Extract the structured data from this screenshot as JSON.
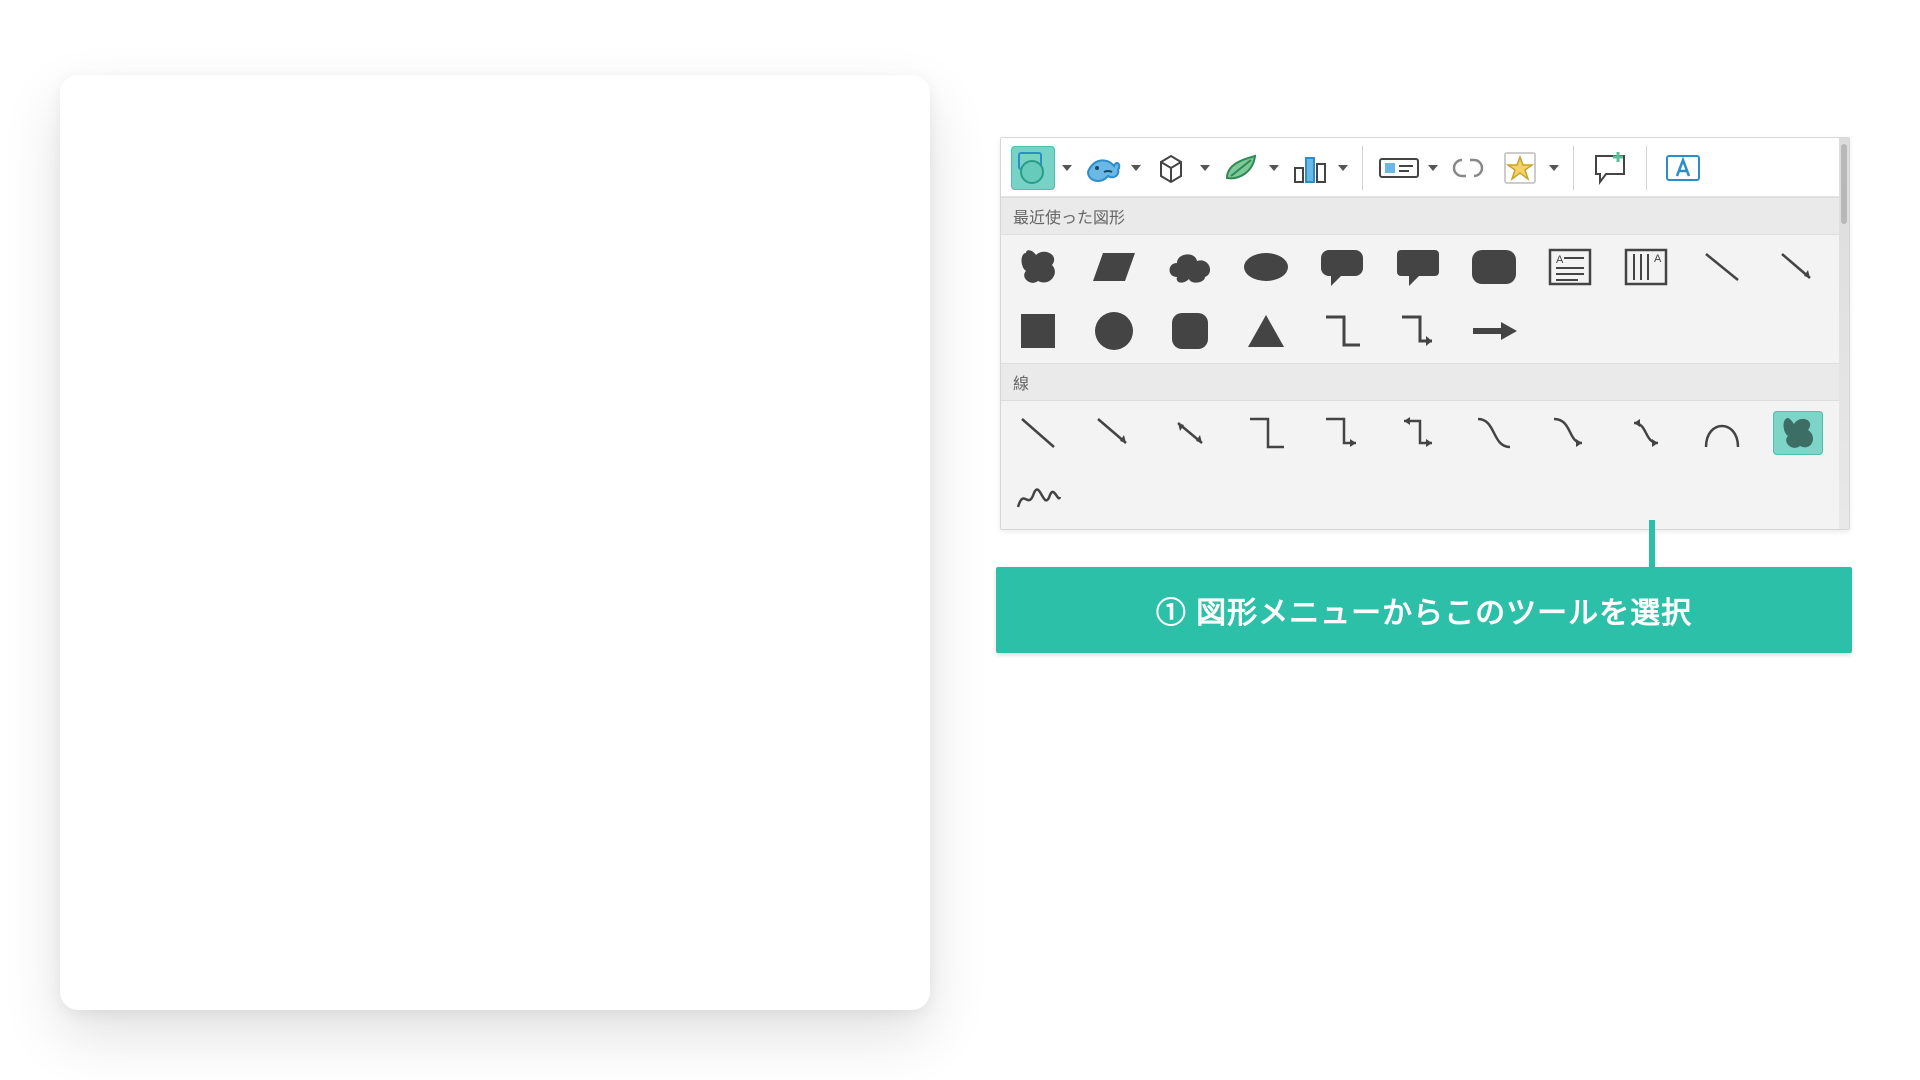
{
  "sections": {
    "recent_label": "最近使った図形",
    "lines_label": "線"
  },
  "callout": {
    "text": "① 図形メニューからこのツールを選択"
  },
  "colors": {
    "accent": "#2cc0a8",
    "highlight": "#7dd5c8",
    "icon_dark": "#444444",
    "icon_blue": "#4da3d6"
  }
}
